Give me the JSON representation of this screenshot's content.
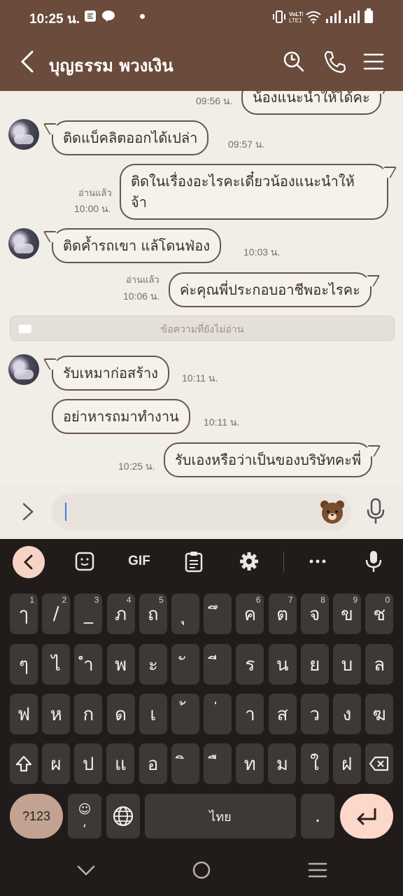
{
  "status_bar": {
    "time": "10:25 น."
  },
  "header": {
    "title": "บุญธรรม พวงเงิน"
  },
  "messages": [
    {
      "id": "m0",
      "side": "out",
      "text": "น้องแนะนำให้ได้คะ",
      "time": "09:56 น.",
      "read": ""
    },
    {
      "id": "m1",
      "side": "in",
      "text": "ติดแบ็คลิตออกได้เปล่า",
      "time": "09:57 น."
    },
    {
      "id": "m2",
      "side": "out",
      "text_line1": "ติดในเรื่องอะไรคะเดี๋ยวน้องแนะนำให้",
      "text_line2": "จ้า",
      "time": "10:00 น.",
      "read": "อ่านแล้ว"
    },
    {
      "id": "m3",
      "side": "in",
      "text": "ติดค้ำรถเขา  แล้โดนฟ่อง",
      "time": "10:03 น."
    },
    {
      "id": "m4",
      "side": "out",
      "text": "ค่ะคุณพี่ประกอบอาชีพอะไรคะ",
      "time": "10:06 น.",
      "read": "อ่านแล้ว"
    },
    {
      "id": "m5",
      "side": "in",
      "text": "รับเหมาก่อสร้าง",
      "time": "10:11 น."
    },
    {
      "id": "m6",
      "side": "in",
      "text": "อย่าหารถมาทำงาน",
      "time": "10:11 น."
    },
    {
      "id": "m7",
      "side": "out",
      "text": "รับเองหรือว่าเป็นของบริษัทคะพี่",
      "time": "10:25 น.",
      "read": ""
    }
  ],
  "unread_divider": "ข้อความที่ยังไม่อ่าน",
  "input": {
    "value": "",
    "placeholder": ""
  },
  "keyboard": {
    "toolbar": {
      "gif": "GIF"
    },
    "row1": [
      [
        "ๅ",
        "1"
      ],
      [
        "/",
        "2"
      ],
      [
        "_",
        "3"
      ],
      [
        "ภ",
        "4"
      ],
      [
        "ถ",
        "5"
      ],
      [
        "ุ",
        ""
      ],
      [
        "ึ",
        ""
      ],
      [
        "ค",
        "6"
      ],
      [
        "ต",
        "7"
      ],
      [
        "จ",
        "8"
      ],
      [
        "ข",
        "9"
      ],
      [
        "ช",
        "0"
      ]
    ],
    "row2": [
      [
        "ๆ",
        ""
      ],
      [
        "ไ",
        ""
      ],
      [
        "ำ",
        ""
      ],
      [
        "พ",
        ""
      ],
      [
        "ะ",
        ""
      ],
      [
        "ั",
        ""
      ],
      [
        "ี",
        ""
      ],
      [
        "ร",
        ""
      ],
      [
        "น",
        ""
      ],
      [
        "ย",
        ""
      ],
      [
        "บ",
        ""
      ],
      [
        "ล",
        ""
      ]
    ],
    "row3": [
      [
        "ฟ",
        ""
      ],
      [
        "ห",
        ""
      ],
      [
        "ก",
        ""
      ],
      [
        "ด",
        ""
      ],
      [
        "เ",
        ""
      ],
      [
        "้",
        ""
      ],
      [
        "่",
        ""
      ],
      [
        "า",
        ""
      ],
      [
        "ส",
        ""
      ],
      [
        "ว",
        ""
      ],
      [
        "ง",
        ""
      ],
      [
        "ฆ",
        ""
      ]
    ],
    "row4": [
      [
        "ผ",
        ""
      ],
      [
        "ป",
        ""
      ],
      [
        "แ",
        ""
      ],
      [
        "อ",
        ""
      ],
      [
        "ิ",
        ""
      ],
      [
        "ื",
        ""
      ],
      [
        "ท",
        ""
      ],
      [
        "ม",
        ""
      ],
      [
        "ใ",
        ""
      ],
      [
        "ฝ",
        ""
      ]
    ],
    "sym_label": "?123",
    "emoji_label": "☺",
    "comma": ",",
    "space_label": "ไทย",
    "period": "."
  }
}
